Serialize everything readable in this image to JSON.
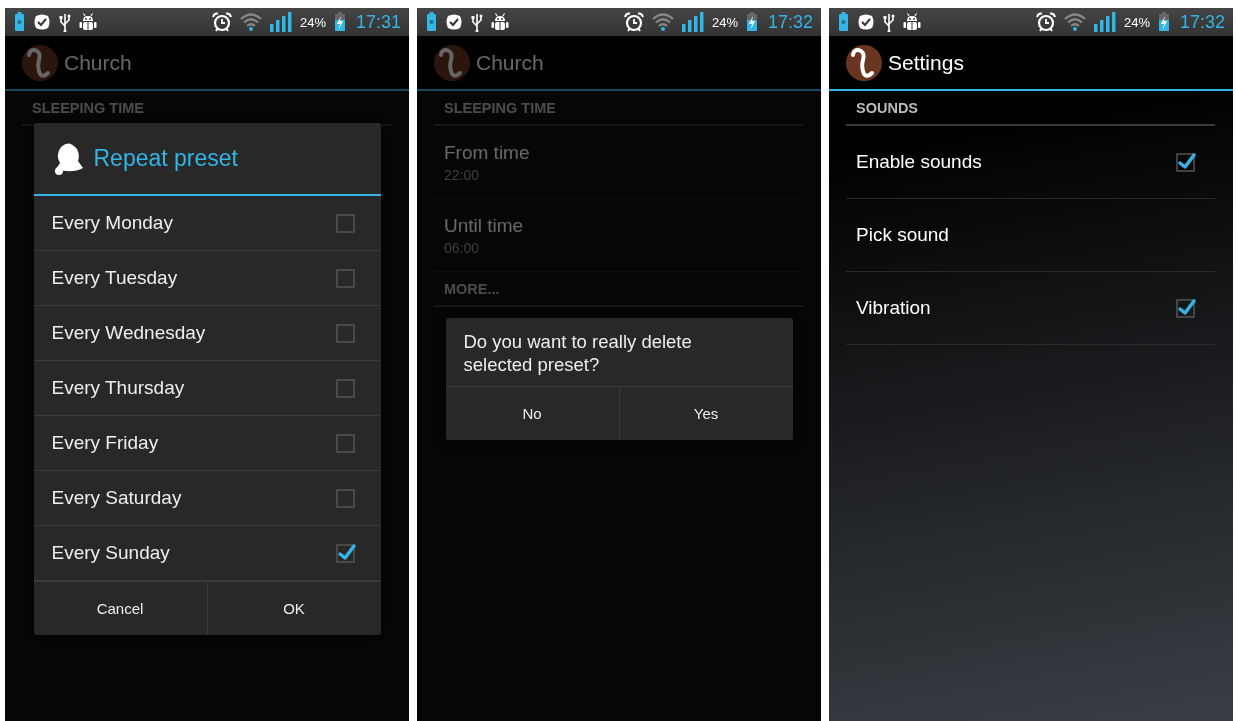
{
  "screens": [
    {
      "status_bar": {
        "battery": "24%",
        "time": "17:31"
      },
      "action_bar": {
        "title": "Church"
      },
      "list": [
        {
          "kind": "header",
          "title": "SLEEPING TIME"
        }
      ],
      "dialog": {
        "kind": "choice",
        "title": "Repeat preset",
        "options": [
          {
            "label": "Every Monday",
            "checked": false
          },
          {
            "label": "Every Tuesday",
            "checked": false
          },
          {
            "label": "Every Wednesday",
            "checked": false
          },
          {
            "label": "Every Thursday",
            "checked": false
          },
          {
            "label": "Every Friday",
            "checked": false
          },
          {
            "label": "Every Saturday",
            "checked": false
          },
          {
            "label": "Every Sunday",
            "checked": true
          }
        ],
        "buttons": [
          "Cancel",
          "OK"
        ]
      }
    },
    {
      "status_bar": {
        "battery": "24%",
        "time": "17:32"
      },
      "action_bar": {
        "title": "Church"
      },
      "list": [
        {
          "kind": "header",
          "title": "SLEEPING TIME"
        },
        {
          "kind": "item",
          "title": "From time",
          "summary": "22:00"
        },
        {
          "kind": "item",
          "title": "Until time",
          "summary": "06:00"
        },
        {
          "kind": "header",
          "title": "MORE..."
        }
      ],
      "dialog": {
        "kind": "confirm",
        "message": "Do you want to really delete selected preset?",
        "buttons": [
          "No",
          "Yes"
        ]
      }
    },
    {
      "status_bar": {
        "battery": "24%",
        "time": "17:32"
      },
      "action_bar": {
        "title": "Settings"
      },
      "list": [
        {
          "kind": "header",
          "title": "SOUNDS"
        },
        {
          "kind": "checkbox",
          "title": "Enable sounds",
          "checked": true
        },
        {
          "kind": "plain",
          "title": "Pick sound"
        },
        {
          "kind": "checkbox",
          "title": "Vibration",
          "checked": true
        }
      ]
    }
  ]
}
